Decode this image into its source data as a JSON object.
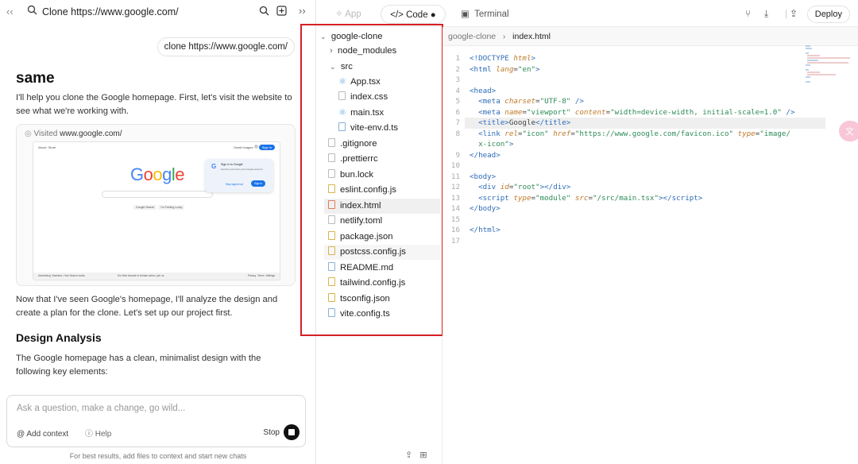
{
  "chat": {
    "header_title": "Clone https://www.google.com/",
    "user_message": "clone https://www.google.com/",
    "brand": "same",
    "intro": "I'll help you clone the Google homepage. First, let's visit the website to see what we're working with.",
    "visited_prefix": "Visited",
    "visited_url": "www.google.com/",
    "after_visit": "Now that I've seen Google's homepage, I'll analyze the design and create a plan for the clone. Let's set up our project first.",
    "section_heading": "Design Analysis",
    "analysis_text": "The Google homepage has a clean, minimalist design with the following key elements:",
    "composer_placeholder": "Ask a question, make a change, go wild...",
    "add_context": "Add context",
    "help": "Help",
    "stop": "Stop",
    "footer": "For best results, add files to context and start new chats"
  },
  "topbar": {
    "app_tab": "App",
    "code_tab": "Code",
    "terminal_tab": "Terminal",
    "deploy": "Deploy"
  },
  "tree": {
    "root": "google-clone",
    "items": [
      "node_modules",
      "src",
      "App.tsx",
      "index.css",
      "main.tsx",
      "vite-env.d.ts",
      ".gitignore",
      ".prettierrc",
      "bun.lock",
      "eslint.config.js",
      "index.html",
      "netlify.toml",
      "package.json",
      "postcss.config.js",
      "README.md",
      "tailwind.config.js",
      "tsconfig.json",
      "vite.config.ts"
    ]
  },
  "editor": {
    "crumb_root": "google-clone",
    "crumb_file": "index.html",
    "line_numbers": [
      "1",
      "2",
      "3",
      "4",
      "5",
      "6",
      "7",
      "8",
      "9",
      "10",
      "11",
      "12",
      "13",
      "14",
      "15",
      "16",
      "17"
    ]
  },
  "mini_google": {
    "logo": "Google",
    "nav_left": [
      "About",
      "Store"
    ],
    "nav_right": [
      "Gmail",
      "Images"
    ],
    "sign_in": "Sign in",
    "popup_title": "Sign in to Google",
    "popup_text": "Get the most from your Google account",
    "popup_stay": "Stay signed out",
    "buttons": [
      "Google Search",
      "I'm Feeling Lucky"
    ],
    "footer_left": [
      "Advertising",
      "Business",
      "How Search works"
    ],
    "footer_mid": "Our third decade of climate action: join us",
    "footer_right": [
      "Privacy",
      "Terms",
      "Settings"
    ]
  }
}
